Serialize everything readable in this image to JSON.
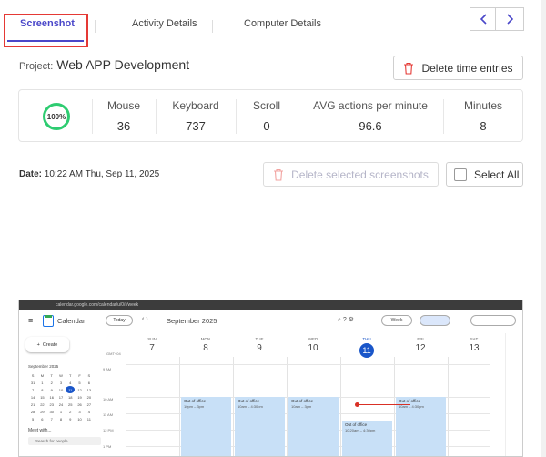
{
  "tabs": [
    {
      "label": "Screenshot",
      "active": true
    },
    {
      "label": "Activity Details",
      "active": false
    },
    {
      "label": "Computer Details",
      "active": false
    }
  ],
  "project": {
    "label": "Project:",
    "name": "Web APP Development"
  },
  "delete_time_entries": "Delete time entries",
  "stats": {
    "percent": "100%",
    "mouse": {
      "label": "Mouse",
      "value": "36"
    },
    "keyboard": {
      "label": "Keyboard",
      "value": "737"
    },
    "scroll": {
      "label": "Scroll",
      "value": "0"
    },
    "avg": {
      "label": "AVG actions per minute",
      "value": "96.6"
    },
    "minutes": {
      "label": "Minutes",
      "value": "8"
    }
  },
  "date": {
    "label": "Date:",
    "value": "10:22 AM Thu, Sep 11, 2025"
  },
  "delete_selected": "Delete selected screenshots",
  "select_all": "Select All",
  "colors": {
    "accent": "#4a47c9",
    "highlight": "#e53935",
    "ring": "#2ecc71"
  },
  "screenshot": {
    "url": "calendar.google.com/calendar/u/0/r/week",
    "app": "Calendar",
    "today_btn": "Today",
    "month": "September 2025",
    "view": "Week",
    "create": "Create",
    "timezone": "GMT+04",
    "days": [
      {
        "name": "SUN",
        "num": "7"
      },
      {
        "name": "MON",
        "num": "8"
      },
      {
        "name": "TUE",
        "num": "9"
      },
      {
        "name": "WED",
        "num": "10"
      },
      {
        "name": "THU",
        "num": "11"
      },
      {
        "name": "FRI",
        "num": "12"
      },
      {
        "name": "SAT",
        "num": "13"
      }
    ],
    "times": [
      "9 AM",
      "10 AM",
      "11 AM",
      "12 PM",
      "1 PM"
    ],
    "events": [
      {
        "title": "Out of office",
        "time": "10pm – 3pm"
      },
      {
        "title": "Out of office",
        "time": "10am – 4:30pm"
      },
      {
        "title": "Out of office",
        "time": "10am – 3pm"
      },
      {
        "title": "Out of office",
        "time": "10:20am – 4:30pm"
      },
      {
        "title": "Out of office",
        "time": "10am – 4:30pm"
      }
    ],
    "mini_month": "September 2025",
    "meet": "Meet with...",
    "search_people": "Search for people"
  }
}
